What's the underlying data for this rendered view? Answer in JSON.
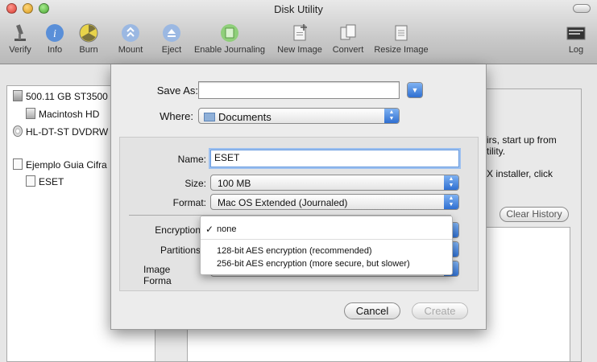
{
  "window": {
    "title": "Disk Utility"
  },
  "toolbar": {
    "verify": "Verify",
    "info": "Info",
    "burn": "Burn",
    "mount": "Mount",
    "eject": "Eject",
    "enable_journaling": "Enable Journaling",
    "new_image": "New Image",
    "convert": "Convert",
    "resize_image": "Resize Image",
    "log": "Log"
  },
  "sidebar": {
    "items": [
      {
        "label": "500.11 GB ST3500"
      },
      {
        "label": "Macintosh HD"
      },
      {
        "label": "HL-DT-ST DVDRW"
      },
      {
        "label": "Ejemplo Guia Cifra"
      },
      {
        "label": "ESET"
      }
    ]
  },
  "background": {
    "partial_text_1": "irs, start up from",
    "partial_text_2": "tility.",
    "partial_text_3": "X installer, click",
    "clear_history": "Clear History"
  },
  "sheet": {
    "save_as_label": "Save As:",
    "save_as_value": "",
    "where_label": "Where:",
    "where_value": "Documents",
    "name_label": "Name:",
    "name_value": "ESET",
    "size_label": "Size:",
    "size_value": "100 MB",
    "format_label": "Format:",
    "format_value": "Mac OS Extended (Journaled)",
    "encryption_label": "Encryption",
    "partitions_label": "Partitions",
    "image_format_label": "Image Forma",
    "cancel": "Cancel",
    "create": "Create"
  },
  "encryption_menu": {
    "selected": "none",
    "options": [
      "none",
      "128-bit AES encryption (recommended)",
      "256-bit AES encryption (more secure, but slower)"
    ]
  },
  "colors": {
    "accent_blue": "#2f6fd1",
    "close": "#e0443e",
    "minimize": "#dea123",
    "zoom": "#5fb844"
  }
}
